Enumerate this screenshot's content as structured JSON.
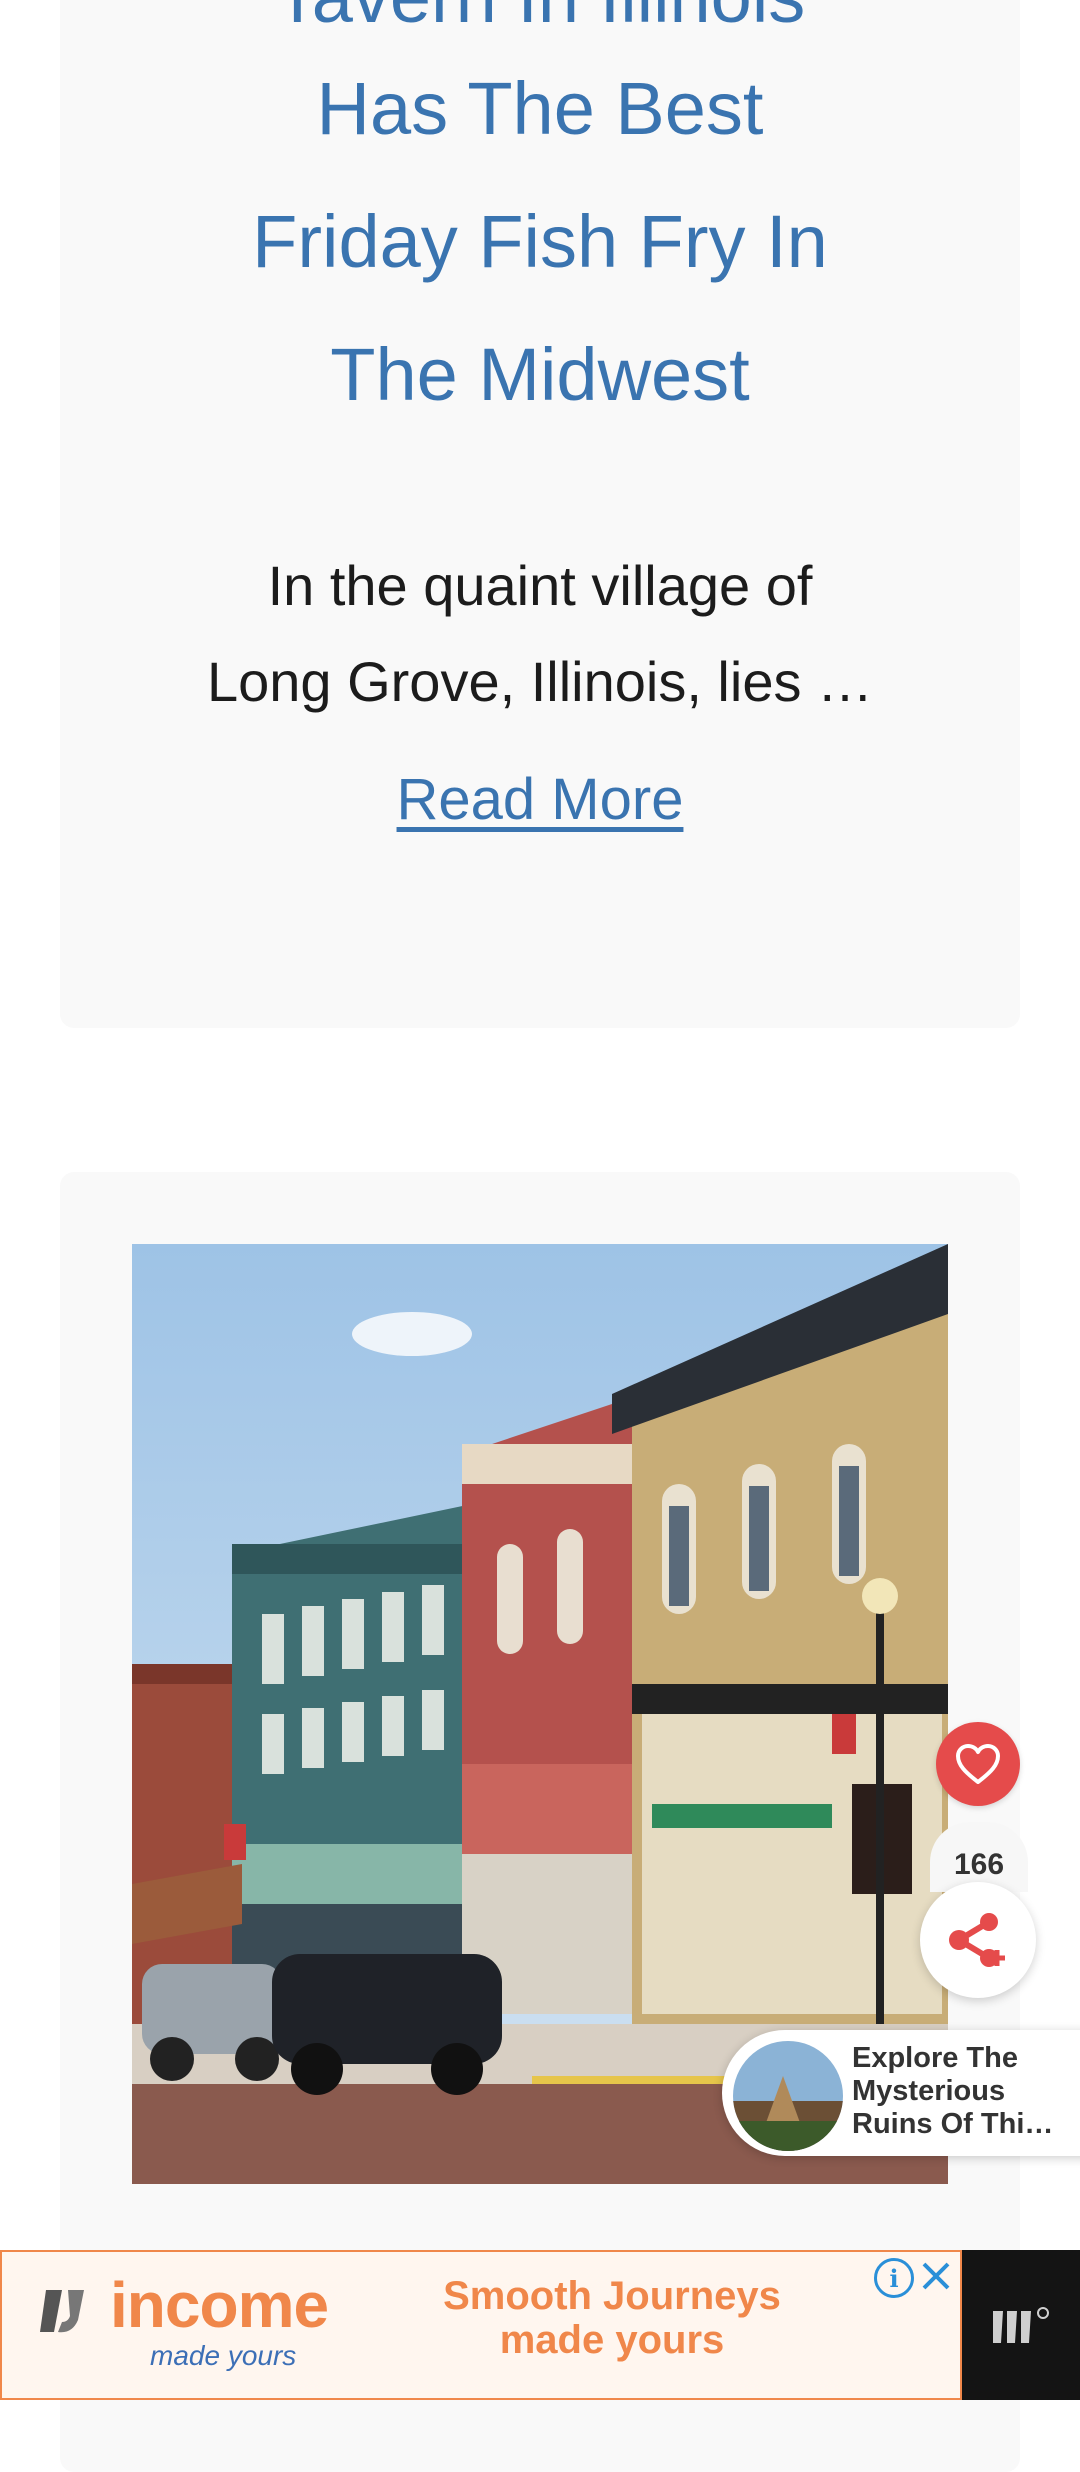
{
  "article_card": {
    "title_lines": [
      "Tavern In Illinois",
      "Has The Best",
      "Friday Fish Fry In",
      "The Midwest"
    ],
    "excerpt_lines": [
      "In the quaint village of",
      "Long Grove, Illinois, lies …"
    ],
    "read_more": "Read More"
  },
  "share_widget": {
    "count": "166",
    "heart_color": "#e54b4b"
  },
  "promo": {
    "lines": [
      "Explore The",
      "Mysterious",
      "Ruins Of Thi…"
    ]
  },
  "ad": {
    "brand": "income",
    "brand_tagline": "made yours",
    "headline_lines": [
      "Smooth Journeys",
      "made yours"
    ],
    "accent_color": "#f0874a"
  },
  "colors": {
    "link": "#3a74b0",
    "card_bg": "#f9f9f9"
  }
}
